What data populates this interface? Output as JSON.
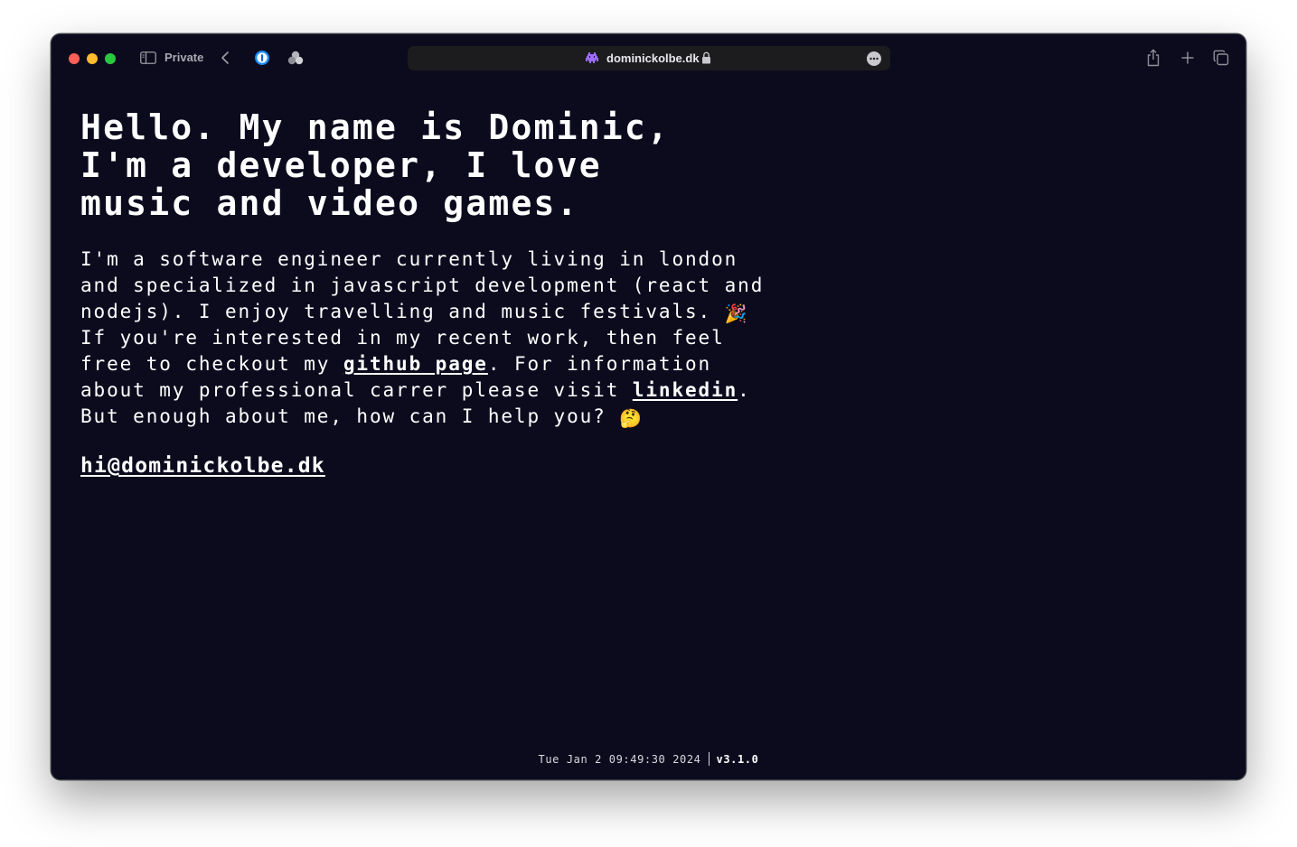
{
  "browser": {
    "private_label": "Private",
    "url": "dominickolbe.dk",
    "icons": [
      "sidebar-icon",
      "back-icon",
      "password-manager-icon",
      "extension-icon",
      "site-favicon",
      "lock-icon",
      "more-icon",
      "share-icon",
      "new-tab-icon",
      "tab-overview-icon"
    ]
  },
  "page": {
    "headline": [
      "Hello. My name is Dominic,",
      "I'm a developer, I love",
      "music and video games."
    ],
    "bio": {
      "line1": "I'm a software engineer currently living in london",
      "line2": "and specialized in javascript development (react and",
      "line3": "nodejs). I enjoy travelling and music festivals. ",
      "line3_emoji": "🎉",
      "line4": "If you're interested in my recent work, then feel",
      "line5_before": "free to checkout my ",
      "github_link": "github page",
      "line5_after": ". For information",
      "line6_before": "about my professional carrer please visit ",
      "linkedin_link": "linkedin",
      "line6_after": ".",
      "line7": "But enough about me, how can I help you? ",
      "line7_emoji": "🤔"
    },
    "email": "hi@dominickolbe.dk",
    "footer": {
      "timestamp": "Tue Jan 2 09:49:30 2024",
      "version": "v3.1.0"
    }
  },
  "colors": {
    "background": "#0c0b1e",
    "text": "#ffffff",
    "address_bar": "#1c1c1f"
  }
}
